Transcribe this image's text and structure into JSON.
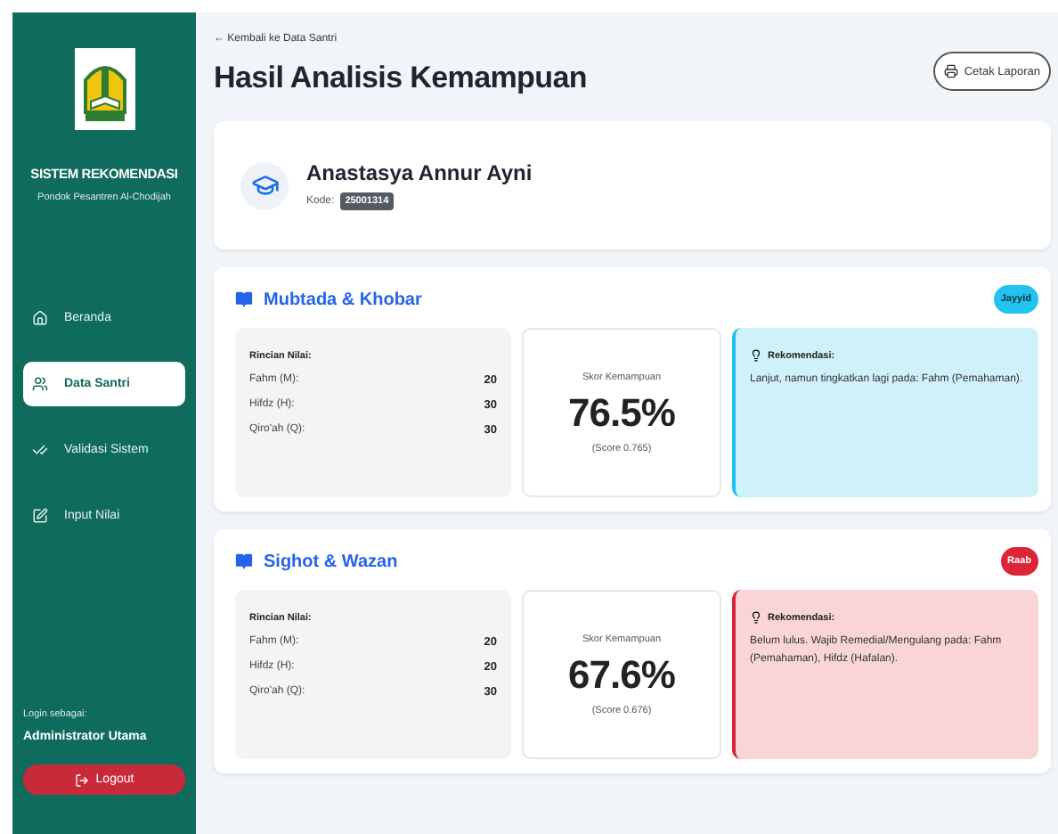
{
  "sidebar": {
    "title": "SISTEM REKOMENDASI",
    "subtitle": "Pondok Pesantren Al-Chodijah",
    "items": [
      {
        "label": "Beranda",
        "selected": false
      },
      {
        "label": "Data Santri",
        "selected": true
      },
      {
        "label": "Validasi Sistem",
        "selected": false
      },
      {
        "label": "Input Nilai",
        "selected": false
      }
    ],
    "login_label": "Login sebagai:",
    "user": "Administrator Utama",
    "logout": "Logout"
  },
  "header": {
    "back": "← Kembali ke Data Santri",
    "title": "Hasil Analisis Kemampuan",
    "print_button": "Cetak Laporan"
  },
  "student": {
    "name": "Anastasya Annur Ayni",
    "code_label": "Kode:",
    "code": "25001314"
  },
  "sections": [
    {
      "title": "Mubtada & Khobar",
      "kind": "pass",
      "badge": "Jayyid",
      "details_title": "Rincian Nilai:",
      "details": [
        {
          "label": "Fahm (M):",
          "value": "20"
        },
        {
          "label": "Hifdz (H):",
          "value": "30"
        },
        {
          "label": "Qiro'ah (Q):",
          "value": "30"
        }
      ],
      "score_label": "Skor Kemampuan",
      "score": "76.5%",
      "score_raw": "(Score 0.765)",
      "rec_title": "Rekomendasi:",
      "rec_text": "Lanjut, namun tingkatkan lagi pada: Fahm (Pemahaman)."
    },
    {
      "title": "Sighot & Wazan",
      "kind": "fail",
      "badge": "Raab",
      "details_title": "Rincian Nilai:",
      "details": [
        {
          "label": "Fahm (M):",
          "value": "20"
        },
        {
          "label": "Hifdz (H):",
          "value": "20"
        },
        {
          "label": "Qiro'ah (Q):",
          "value": "30"
        }
      ],
      "score_label": "Skor Kemampuan",
      "score": "67.6%",
      "score_raw": "(Score 0.676)",
      "rec_title": "Rekomendasi:",
      "rec_text": "Belum lulus. Wajib Remedial/Mengulang pada: Fahm (Pemahaman), Hifdz (Hafalan)."
    }
  ]
}
